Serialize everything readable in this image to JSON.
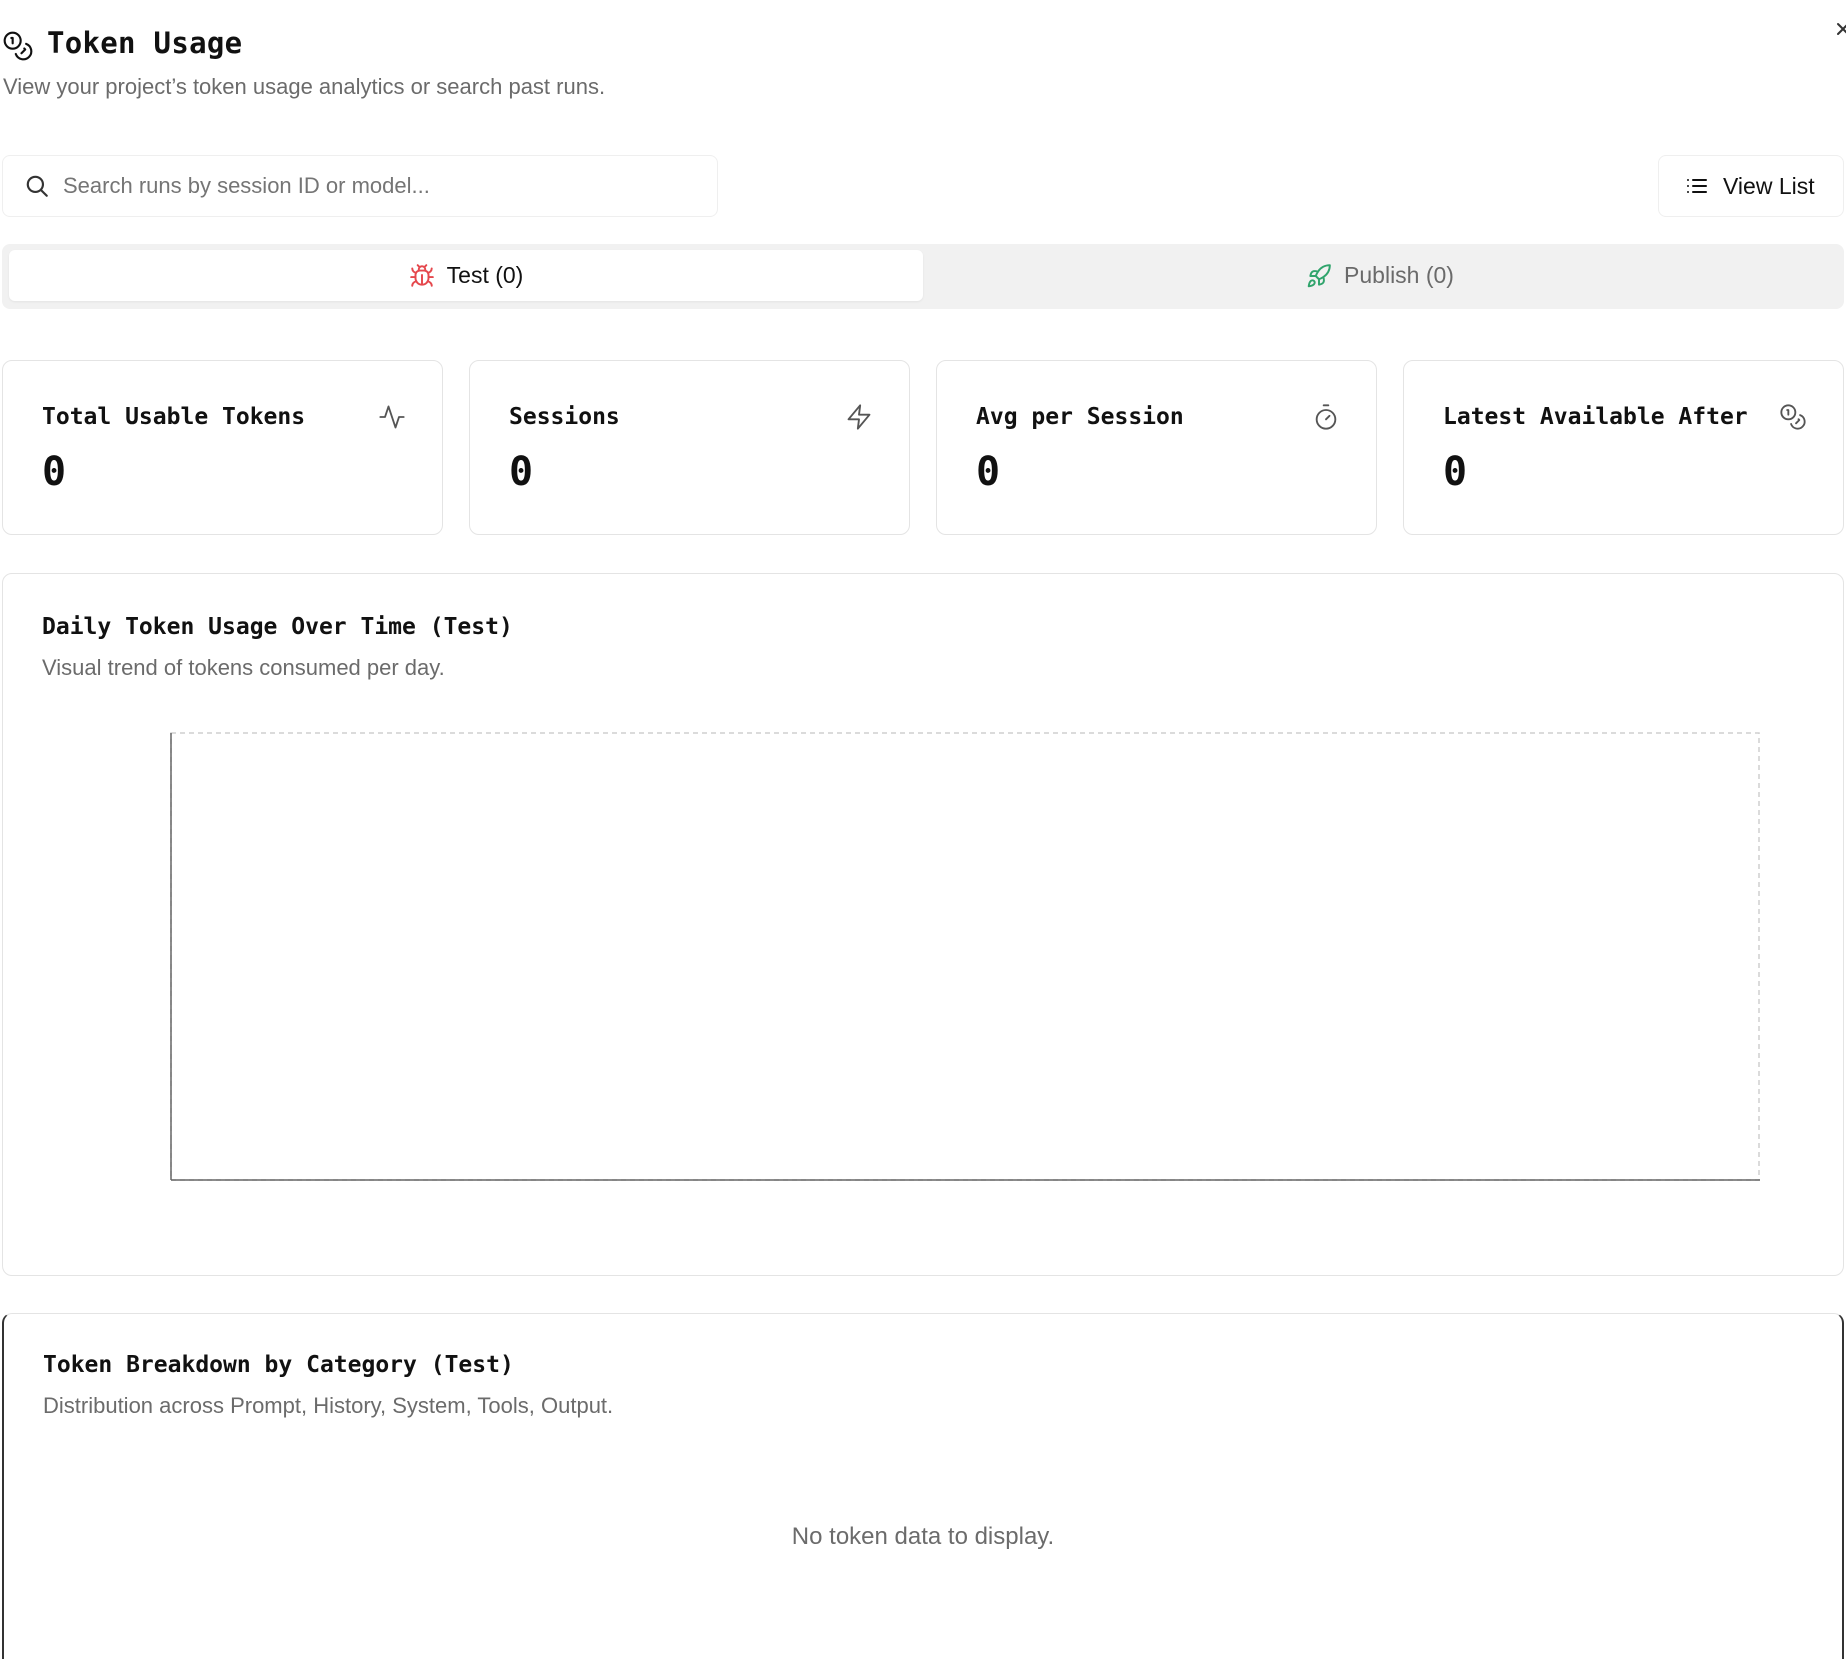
{
  "header": {
    "icon": "coins-icon",
    "title": "Token Usage",
    "subtitle": "View your project’s token usage analytics or search past runs.",
    "close_icon": "close-icon"
  },
  "search": {
    "icon": "search-icon",
    "placeholder": "Search runs by session ID or model...",
    "value": ""
  },
  "view_list": {
    "icon": "list-icon",
    "label": "View List"
  },
  "tabs": [
    {
      "label": "Test (0)",
      "icon": "bug-icon",
      "icon_color": "#e5484d",
      "active": true
    },
    {
      "label": "Publish (0)",
      "icon": "rocket-icon",
      "icon_color": "#30a46c",
      "active": false
    }
  ],
  "stats": [
    {
      "title": "Total Usable Tokens",
      "value": "0",
      "icon": "activity-icon"
    },
    {
      "title": "Sessions",
      "value": "0",
      "icon": "zap-icon"
    },
    {
      "title": "Avg per Session",
      "value": "0",
      "icon": "timer-icon"
    },
    {
      "title": "Latest Available After",
      "value": "0",
      "icon": "coins-icon"
    }
  ],
  "daily_chart": {
    "title": "Daily Token Usage Over Time (Test)",
    "subtitle": "Visual trend of tokens consumed per day."
  },
  "breakdown": {
    "title": "Token Breakdown by Category (Test)",
    "subtitle": "Distribution across Prompt, History, System, Tools, Output.",
    "empty_message": "No token data to display."
  },
  "chart_data": {
    "type": "line",
    "x": [],
    "series": [],
    "title": "Daily Token Usage Over Time (Test)",
    "xlabel": "",
    "ylabel": "",
    "grid": false
  },
  "colors": {
    "test_accent": "#e5484d",
    "publish_accent": "#30a46c",
    "muted_text": "#6b6b6b"
  }
}
